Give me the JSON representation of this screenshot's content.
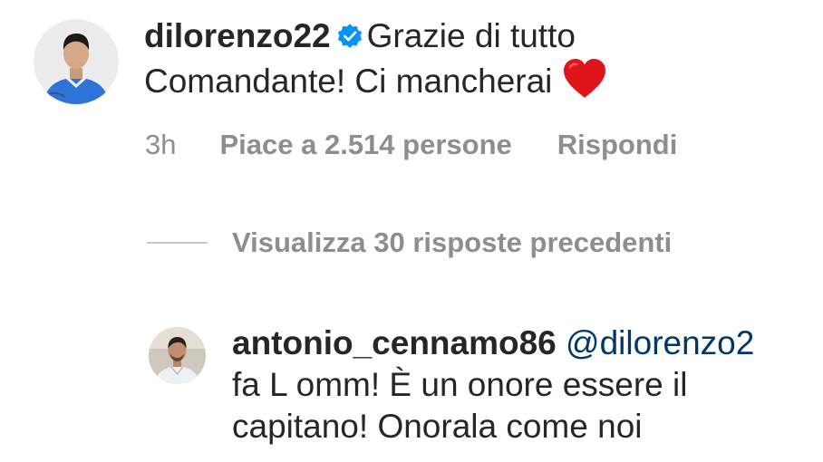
{
  "main_comment": {
    "username": "dilorenzo22",
    "verified": true,
    "text_line1": "Grazie di tutto",
    "text_line2": "Comandante! Ci mancherai",
    "emoji": "heart",
    "time": "3h",
    "likes": "Piace a 2.514 persone",
    "reply_label": "Rispondi"
  },
  "view_replies": {
    "label": "Visualizza 30 risposte precedenti"
  },
  "reply_comment": {
    "username": "antonio_cennamo86",
    "mention": "@dilorenzo2",
    "text_line1": "fa L omm! È un onore essere il",
    "text_line2": "capitano! Onorala come noi"
  },
  "colors": {
    "text": "#262626",
    "secondary": "#8e8e8e",
    "mention": "#00376b",
    "verified": "#0095f6",
    "heart": "#e0151c"
  }
}
